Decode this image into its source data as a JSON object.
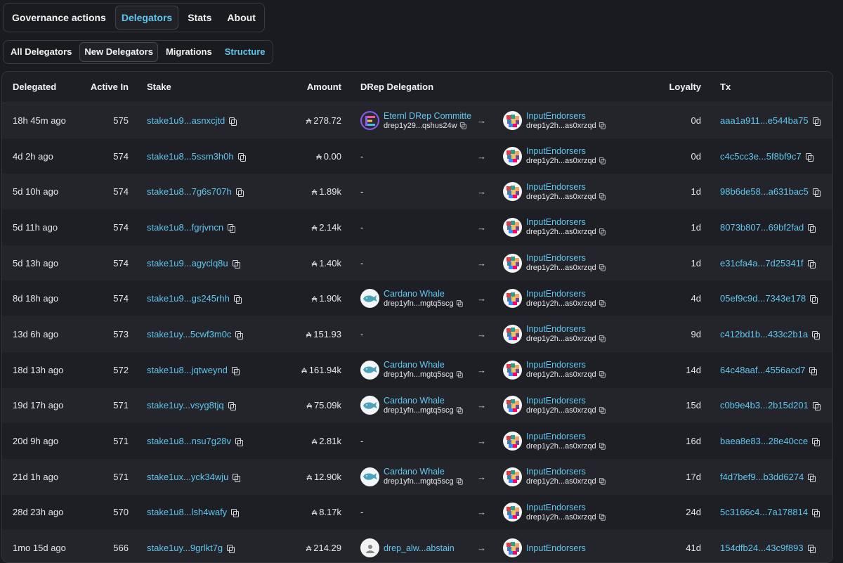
{
  "topnav": {
    "tabs": [
      {
        "label": "Governance actions",
        "active": false
      },
      {
        "label": "Delegators",
        "active": true
      },
      {
        "label": "Stats",
        "active": false
      },
      {
        "label": "About",
        "active": false
      }
    ]
  },
  "subnav": {
    "tabs": [
      {
        "label": "All Delegators",
        "active": false
      },
      {
        "label": "New Delegators",
        "active": true
      },
      {
        "label": "Migrations",
        "active": false
      },
      {
        "label": "Structure",
        "active": false
      }
    ]
  },
  "table": {
    "headers": {
      "delegated": "Delegated",
      "active_in": "Active In",
      "stake": "Stake",
      "amount": "Amount",
      "drep_delegation": "DRep Delegation",
      "loyalty": "Loyalty",
      "tx": "Tx"
    },
    "ada_symbol": "₳",
    "arrow": "→",
    "rows": [
      {
        "delegated": "18h 45m ago",
        "active_in": "575",
        "stake": "stake1u9...asnxcjtd",
        "amount": "278.72",
        "from_name": "Eternl DRep Committee",
        "from_id": "drep1y29...qshus24w",
        "from_avatar": "eternl-avatar",
        "to_name": "InputEndorsers",
        "to_id": "drep1y2h...as0xrzqd",
        "loyalty": "0d",
        "tx": "aaa1a911...e544ba75"
      },
      {
        "delegated": "4d 2h ago",
        "active_in": "574",
        "stake": "stake1u8...5ssm3h0h",
        "amount": "0.00",
        "from_name": "-",
        "from_id": "",
        "from_avatar": "",
        "to_name": "InputEndorsers",
        "to_id": "drep1y2h...as0xrzqd",
        "loyalty": "0d",
        "tx": "c4c5cc3e...5f8bf9c7"
      },
      {
        "delegated": "5d 10h ago",
        "active_in": "574",
        "stake": "stake1u8...7g6s707h",
        "amount": "1.89k",
        "from_name": "-",
        "from_id": "",
        "from_avatar": "",
        "to_name": "InputEndorsers",
        "to_id": "drep1y2h...as0xrzqd",
        "loyalty": "1d",
        "tx": "98b6de58...a631bac5"
      },
      {
        "delegated": "5d 11h ago",
        "active_in": "574",
        "stake": "stake1u8...fgrjvncn",
        "amount": "2.14k",
        "from_name": "-",
        "from_id": "",
        "from_avatar": "",
        "to_name": "InputEndorsers",
        "to_id": "drep1y2h...as0xrzqd",
        "loyalty": "1d",
        "tx": "8073b807...69bf2fad"
      },
      {
        "delegated": "5d 13h ago",
        "active_in": "574",
        "stake": "stake1u9...agyclq8u",
        "amount": "1.40k",
        "from_name": "-",
        "from_id": "",
        "from_avatar": "",
        "to_name": "InputEndorsers",
        "to_id": "drep1y2h...as0xrzqd",
        "loyalty": "1d",
        "tx": "e31cfa4a...7d25341f"
      },
      {
        "delegated": "8d 18h ago",
        "active_in": "574",
        "stake": "stake1u9...gs245rhh",
        "amount": "1.90k",
        "from_name": "Cardano Whale",
        "from_id": "drep1yfn...mgtq5scg",
        "from_avatar": "whale-avatar",
        "to_name": "InputEndorsers",
        "to_id": "drep1y2h...as0xrzqd",
        "loyalty": "4d",
        "tx": "05ef9c9d...7343e178"
      },
      {
        "delegated": "13d 6h ago",
        "active_in": "573",
        "stake": "stake1uy...5cwf3m0c",
        "amount": "151.93",
        "from_name": "-",
        "from_id": "",
        "from_avatar": "",
        "to_name": "InputEndorsers",
        "to_id": "drep1y2h...as0xrzqd",
        "loyalty": "9d",
        "tx": "c412bd1b...433c2b1a"
      },
      {
        "delegated": "18d 13h ago",
        "active_in": "572",
        "stake": "stake1u8...jqtweynd",
        "amount": "161.94k",
        "from_name": "Cardano Whale",
        "from_id": "drep1yfn...mgtq5scg",
        "from_avatar": "whale-avatar",
        "to_name": "InputEndorsers",
        "to_id": "drep1y2h...as0xrzqd",
        "loyalty": "14d",
        "tx": "64c48aaf...4556acd7"
      },
      {
        "delegated": "19d 17h ago",
        "active_in": "571",
        "stake": "stake1uy...vsyg8tjq",
        "amount": "75.09k",
        "from_name": "Cardano Whale",
        "from_id": "drep1yfn...mgtq5scg",
        "from_avatar": "whale-avatar",
        "to_name": "InputEndorsers",
        "to_id": "drep1y2h...as0xrzqd",
        "loyalty": "15d",
        "tx": "c0b9e4b3...2b15d201"
      },
      {
        "delegated": "20d 9h ago",
        "active_in": "571",
        "stake": "stake1u8...nsu7g28v",
        "amount": "2.81k",
        "from_name": "-",
        "from_id": "",
        "from_avatar": "",
        "to_name": "InputEndorsers",
        "to_id": "drep1y2h...as0xrzqd",
        "loyalty": "16d",
        "tx": "baea8e83...28e40cce"
      },
      {
        "delegated": "21d 1h ago",
        "active_in": "571",
        "stake": "stake1ux...yck34wju",
        "amount": "12.90k",
        "from_name": "Cardano Whale",
        "from_id": "drep1yfn...mgtq5scg",
        "from_avatar": "whale-avatar",
        "to_name": "InputEndorsers",
        "to_id": "drep1y2h...as0xrzqd",
        "loyalty": "17d",
        "tx": "f4d7bef9...b3dd6274"
      },
      {
        "delegated": "28d 23h ago",
        "active_in": "570",
        "stake": "stake1u8...lsh4wafy",
        "amount": "8.17k",
        "from_name": "-",
        "from_id": "",
        "from_avatar": "",
        "to_name": "InputEndorsers",
        "to_id": "drep1y2h...as0xrzqd",
        "loyalty": "24d",
        "tx": "5c3166c4...7a178814"
      },
      {
        "delegated": "1mo 15d ago",
        "active_in": "566",
        "stake": "stake1uy...9grlkt7g",
        "amount": "214.29",
        "from_name": "drep_alw...abstain",
        "from_id": "",
        "from_avatar": "plain-avatar",
        "to_name": "InputEndorsers",
        "to_id": "",
        "loyalty": "41d",
        "tx": "154dfb24...43c9f893"
      }
    ]
  }
}
